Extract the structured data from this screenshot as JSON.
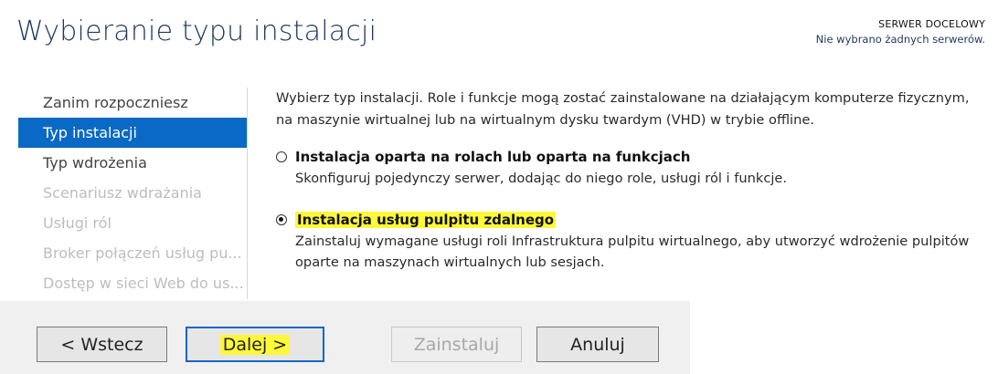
{
  "header": {
    "title": "Wybieranie typu instalacji",
    "server_heading": "SERWER DOCELOWY",
    "server_value": "Nie wybrano żadnych serwerów."
  },
  "nav": {
    "items": [
      {
        "label": "Zanim rozpoczniesz",
        "state": "normal"
      },
      {
        "label": "Typ instalacji",
        "state": "active"
      },
      {
        "label": "Typ wdrożenia",
        "state": "normal"
      },
      {
        "label": "Scenariusz wdrażania",
        "state": "disabled"
      },
      {
        "label": "Usługi ról",
        "state": "disabled"
      },
      {
        "label": "Broker połączeń usług pu...",
        "state": "disabled"
      },
      {
        "label": "Dostęp w sieci Web do us...",
        "state": "disabled"
      }
    ]
  },
  "content": {
    "description_line1": "Wybierz typ instalacji. Role i funkcje mogą zostać zainstalowane na działającym komputerze fizycznym,",
    "description_line2": "na maszynie wirtualnej lub na wirtualnym dysku twardym (VHD) w trybie offline.",
    "options": [
      {
        "label": "Instalacja oparta na rolach lub oparta na funkcjach",
        "desc_line1": "Skonfiguruj pojedynczy serwer, dodając do niego role, usługi ról i funkcje.",
        "desc_line2": "",
        "selected": false
      },
      {
        "label": "Instalacja usług pulpitu zdalnego",
        "desc_line1": "Zainstaluj wymagane usługi roli Infrastruktura pulpitu wirtualnego, aby utworzyć wdrożenie pulpitów",
        "desc_line2": "oparte na maszynach wirtualnych lub sesjach.",
        "selected": true
      }
    ]
  },
  "buttons": {
    "back": "< Wstecz",
    "next": "Dalej >",
    "install": "Zainstaluj",
    "cancel": "Anuluj"
  },
  "colors": {
    "accent": "#0a69c4",
    "highlight": "#fdf83a",
    "title": "#1e3a5f"
  }
}
